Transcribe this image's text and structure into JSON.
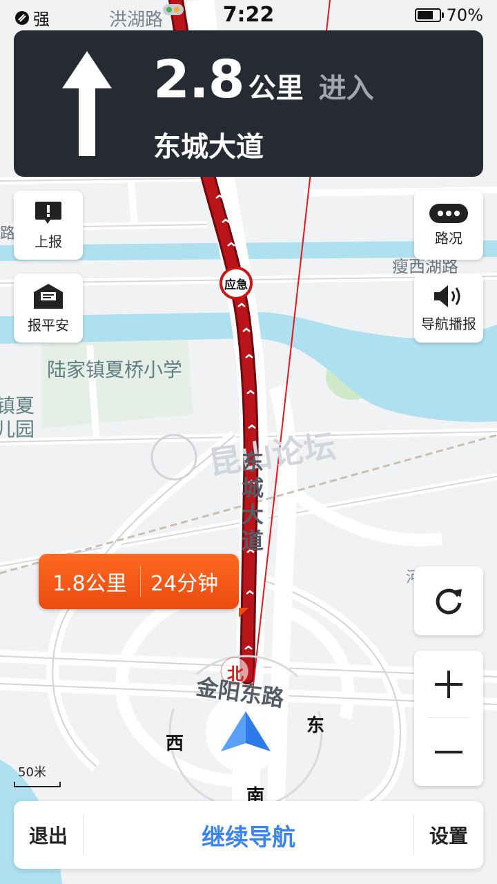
{
  "status_bar": {
    "signal_label": "强",
    "time": "7:22",
    "battery": "70%"
  },
  "guidance": {
    "distance": "2.8",
    "unit": "公里",
    "action": "进入",
    "road": "东城大道"
  },
  "left_buttons": {
    "report": "上报",
    "safe": "报平安"
  },
  "right_buttons": {
    "traffic": "路况",
    "voice": "导航播报"
  },
  "map_labels": {
    "top_road": "洪湖路",
    "school": "陆家镇夏桥小学",
    "park_1": "镇夏",
    "park_2": "儿园",
    "right_road": "瘦西湖路",
    "left_frag": "静路",
    "main_road": "东城大道",
    "cross_road": "金阳东路",
    "emergency": "应急",
    "watermark": "昆山论坛",
    "right_frag": "河"
  },
  "eta": {
    "distance": "1.8公里",
    "time": "24分钟"
  },
  "compass": {
    "north": "北",
    "south": "南",
    "east": "东",
    "west": "西"
  },
  "scale": "50米",
  "bottom_bar": {
    "exit": "退出",
    "continue": "继续导航",
    "settings": "设置"
  },
  "colors": {
    "route": "#b8141a",
    "guide_bg": "#262b33",
    "eta": "#ec4a10",
    "accent": "#3a84f0",
    "water": "#aee0ef"
  }
}
